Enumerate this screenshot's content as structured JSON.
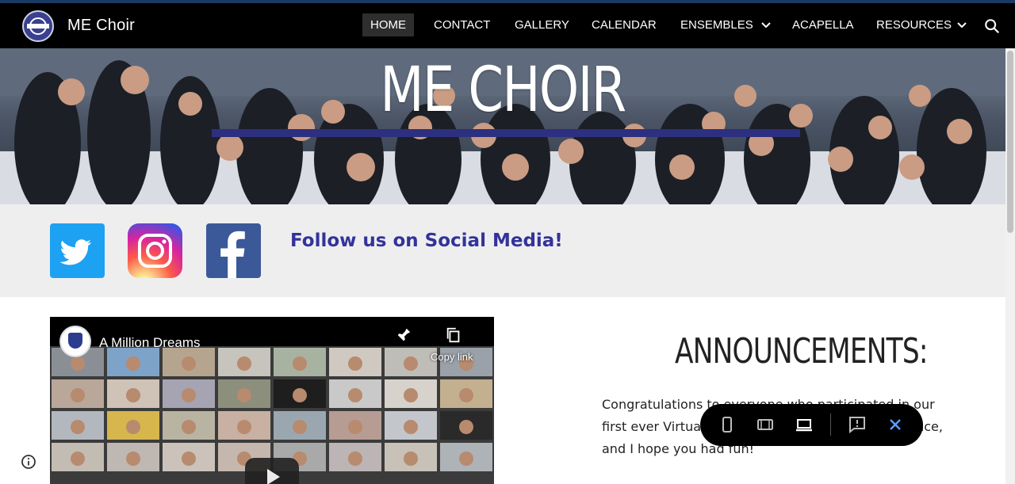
{
  "site": {
    "title": "ME Choir"
  },
  "nav": {
    "items": [
      {
        "label": "HOME"
      },
      {
        "label": "CONTACT"
      },
      {
        "label": "GALLERY"
      },
      {
        "label": "CALENDAR"
      },
      {
        "label": "ENSEMBLES"
      },
      {
        "label": "ACAPELLA"
      },
      {
        "label": "RESOURCES"
      }
    ],
    "active": "HOME"
  },
  "hero": {
    "title": "ME CHOIR"
  },
  "social": {
    "follow_text": "Follow us on Social Media!",
    "icons": [
      "twitter-icon",
      "instagram-icon",
      "facebook-icon"
    ]
  },
  "video": {
    "title": "A Million Dreams",
    "copy_label": "Copy link"
  },
  "announcements": {
    "title": "ANNOUNCEMENTS:",
    "body": "Congratulations to everyone who participated in our first ever Virtual Choir. It was an amazing experience, and I hope you had fun!"
  },
  "colors": {
    "nav_bg": "#000000",
    "accent_bar": "#2d2f80",
    "follow_text": "#33339a",
    "social_band": "#eeeeef"
  }
}
